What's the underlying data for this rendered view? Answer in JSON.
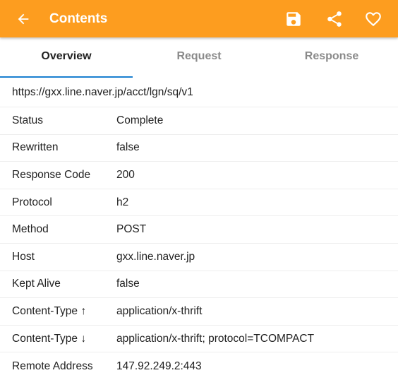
{
  "appbar": {
    "title": "Contents",
    "color": "#fd9d1f",
    "icons": [
      "back-arrow-icon",
      "save-icon",
      "share-icon",
      "heart-icon"
    ]
  },
  "tabs": [
    {
      "label": "Overview",
      "active": true
    },
    {
      "label": "Request",
      "active": false
    },
    {
      "label": "Response",
      "active": false
    }
  ],
  "overview": {
    "url": "https://gxx.line.naver.jp/acct/lgn/sq/v1",
    "rows": [
      {
        "key": "Status",
        "value": "Complete"
      },
      {
        "key": "Rewritten",
        "value": "false"
      },
      {
        "key": "Response Code",
        "value": "200"
      },
      {
        "key": "Protocol",
        "value": "h2"
      },
      {
        "key": "Method",
        "value": "POST"
      },
      {
        "key": "Host",
        "value": "gxx.line.naver.jp"
      },
      {
        "key": "Kept Alive",
        "value": "false"
      },
      {
        "key": "Content-Type ↑",
        "value": "application/x-thrift"
      },
      {
        "key": "Content-Type ↓",
        "value": "application/x-thrift; protocol=TCOMPACT"
      },
      {
        "key": "Remote Address",
        "value": "147.92.249.2:443"
      }
    ]
  }
}
